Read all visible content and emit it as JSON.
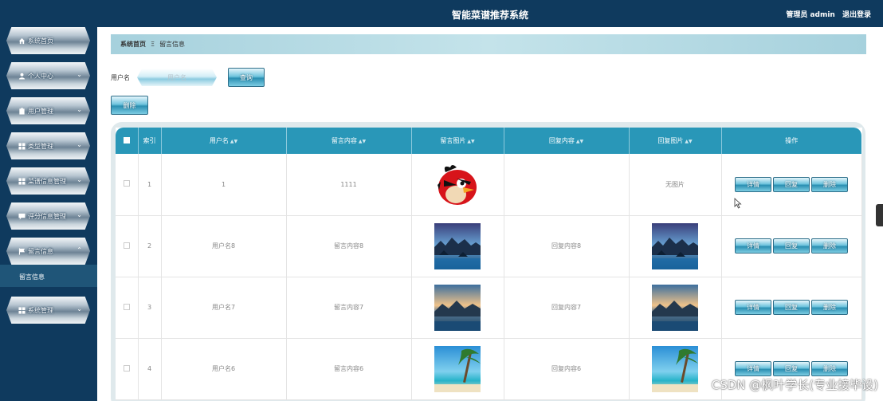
{
  "header": {
    "title": "智能菜谱推荐系统",
    "user": "管理员 admin",
    "logout": "退出登录"
  },
  "sidebar": {
    "items": [
      {
        "label": "系统首页",
        "icon": "home-icon",
        "has_chevron": false
      },
      {
        "label": "个人中心",
        "icon": "user-icon",
        "has_chevron": true
      },
      {
        "label": "用户管理",
        "icon": "clipboard-icon",
        "has_chevron": true
      },
      {
        "label": "类型管理",
        "icon": "grid-icon",
        "has_chevron": true
      },
      {
        "label": "菜谱信息管理",
        "icon": "grid-icon",
        "has_chevron": true
      },
      {
        "label": "评分信息管理",
        "icon": "comment-icon",
        "has_chevron": true
      },
      {
        "label": "留言信息",
        "icon": "flag-icon",
        "has_chevron": true,
        "expanded": true
      },
      {
        "label": "系统管理",
        "icon": "grid-icon",
        "has_chevron": true
      }
    ],
    "sub_item": "留言信息"
  },
  "breadcrumb": {
    "home": "系统首页",
    "separator": "Ξ",
    "current": "留言信息"
  },
  "search": {
    "label": "用户名",
    "placeholder": "用户名",
    "button": "查询"
  },
  "toolbar": {
    "delete": "删除"
  },
  "table": {
    "headers": [
      "索引",
      "用户名",
      "留言内容",
      "留言图片",
      "回复内容",
      "回复图片",
      "操作"
    ],
    "rows": [
      {
        "index": "1",
        "username": "1",
        "content": "1111",
        "image": "angry-bird",
        "reply": "",
        "reply_image": "none",
        "reply_image_text": "无图片"
      },
      {
        "index": "2",
        "username": "用户名8",
        "content": "留言内容8",
        "image": "lake",
        "reply": "回复内容8",
        "reply_image": "lake"
      },
      {
        "index": "3",
        "username": "用户名7",
        "content": "留言内容7",
        "image": "sunset",
        "reply": "回复内容7",
        "reply_image": "sunset"
      },
      {
        "index": "4",
        "username": "用户名6",
        "content": "留言内容6",
        "image": "beach",
        "reply": "回复内容6",
        "reply_image": "beach"
      }
    ],
    "actions": {
      "detail": "详情",
      "reply": "回复",
      "delete": "删除"
    }
  },
  "watermark": "CSDN @枫叶学长(专业接毕设)"
}
